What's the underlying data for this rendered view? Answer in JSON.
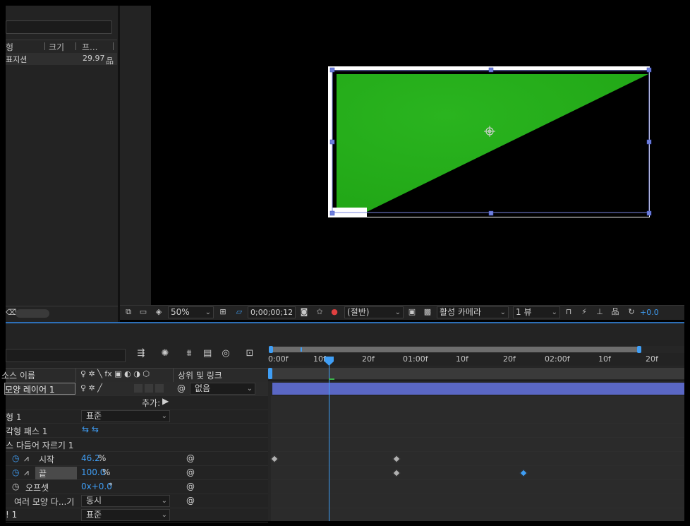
{
  "project": {
    "columns": [
      "형",
      "크기",
      "프..."
    ],
    "row": {
      "name": "표지션",
      "value": "29.97"
    }
  },
  "viewer": {
    "zoom": "50%",
    "timecode": "0;00;00;12",
    "resolution": "(절반)",
    "camera": "활성 카메라",
    "views": "1 뷰",
    "exposure": "+0.0"
  },
  "timeline": {
    "ruler_ticks": [
      "0:00f",
      "10f",
      "20f",
      "01:00f",
      "10f",
      "20f",
      "02:00f",
      "10f",
      "20f"
    ],
    "header": {
      "source_name": "소스 이름",
      "parent_link": "상위 및 링크"
    },
    "layer": {
      "name": "모양 레이어 1",
      "parent": "없음"
    },
    "add_label": "추가:",
    "rows": [
      {
        "label": "형 1",
        "value": "표준"
      },
      {
        "label": "각형 패스 1"
      },
      {
        "label": "스 다듬어 자르기 1"
      },
      {
        "label": "시작",
        "value": "46.2",
        "unit": "%"
      },
      {
        "label": "끝",
        "value": "100.0",
        "unit": "%"
      },
      {
        "label": "오프셋",
        "value": "0x+0.0",
        "unit": "°"
      },
      {
        "label": "여러 모양 다...기",
        "value": "동시"
      },
      {
        "label": "! 1",
        "value": "표준"
      }
    ]
  },
  "colors": {
    "shape_fill": "#27b31e",
    "accent": "#3f9ef5",
    "layer_bar": "#5a67c4"
  }
}
